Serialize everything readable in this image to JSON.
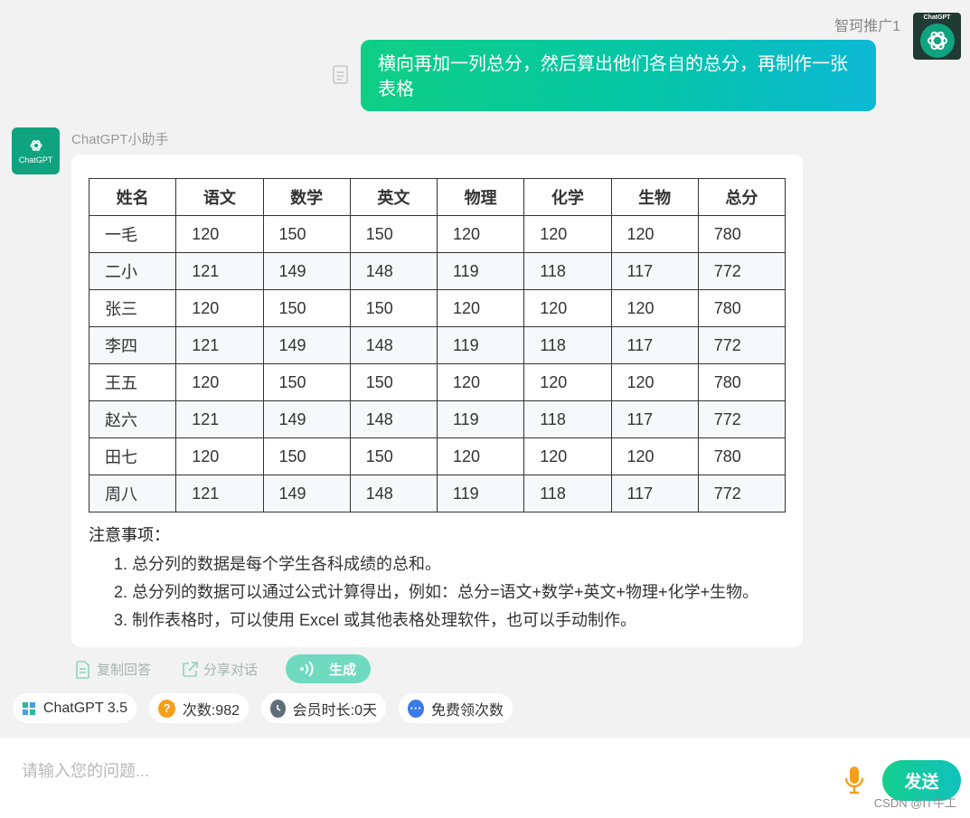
{
  "user": {
    "name": "智珂推广1",
    "avatar_text": "ChatGPT",
    "message": "横向再加一列总分，然后算出他们各自的总分，再制作一张表格"
  },
  "bot": {
    "name": "ChatGPT小助手",
    "avatar_text": "ChatGPT",
    "table": {
      "headers": [
        "姓名",
        "语文",
        "数学",
        "英文",
        "物理",
        "化学",
        "生物",
        "总分"
      ],
      "rows": [
        [
          "一毛",
          "120",
          "150",
          "150",
          "120",
          "120",
          "120",
          "780"
        ],
        [
          "二小",
          "121",
          "149",
          "148",
          "119",
          "118",
          "117",
          "772"
        ],
        [
          "张三",
          "120",
          "150",
          "150",
          "120",
          "120",
          "120",
          "780"
        ],
        [
          "李四",
          "121",
          "149",
          "148",
          "119",
          "118",
          "117",
          "772"
        ],
        [
          "王五",
          "120",
          "150",
          "150",
          "120",
          "120",
          "120",
          "780"
        ],
        [
          "赵六",
          "121",
          "149",
          "148",
          "119",
          "118",
          "117",
          "772"
        ],
        [
          "田七",
          "120",
          "150",
          "150",
          "120",
          "120",
          "120",
          "780"
        ],
        [
          "周八",
          "121",
          "149",
          "148",
          "119",
          "118",
          "117",
          "772"
        ]
      ]
    },
    "notes_title": "注意事项：",
    "notes": [
      "1. 总分列的数据是每个学生各科成绩的总和。",
      "2. 总分列的数据可以通过公式计算得出，例如：总分=语文+数学+英文+物理+化学+生物。",
      "3. 制作表格时，可以使用 Excel 或其他表格处理软件，也可以手动制作。"
    ]
  },
  "actions": {
    "copy": "复制回答",
    "share": "分享对话",
    "generate": "生成"
  },
  "pills": {
    "model": "ChatGPT 3.5",
    "count": "次数:982",
    "membership": "会员时长:0天",
    "free": "免费领次数"
  },
  "input": {
    "placeholder": "请输入您的问题...",
    "send": "发送"
  },
  "watermark": "CSDN @IT牛工",
  "colors": {
    "accent": "#10a37f",
    "bubble_start": "#0fcf85",
    "bubble_end": "#0cb8d4",
    "generate": "#6fdac0",
    "mic": "#f5a01a"
  }
}
